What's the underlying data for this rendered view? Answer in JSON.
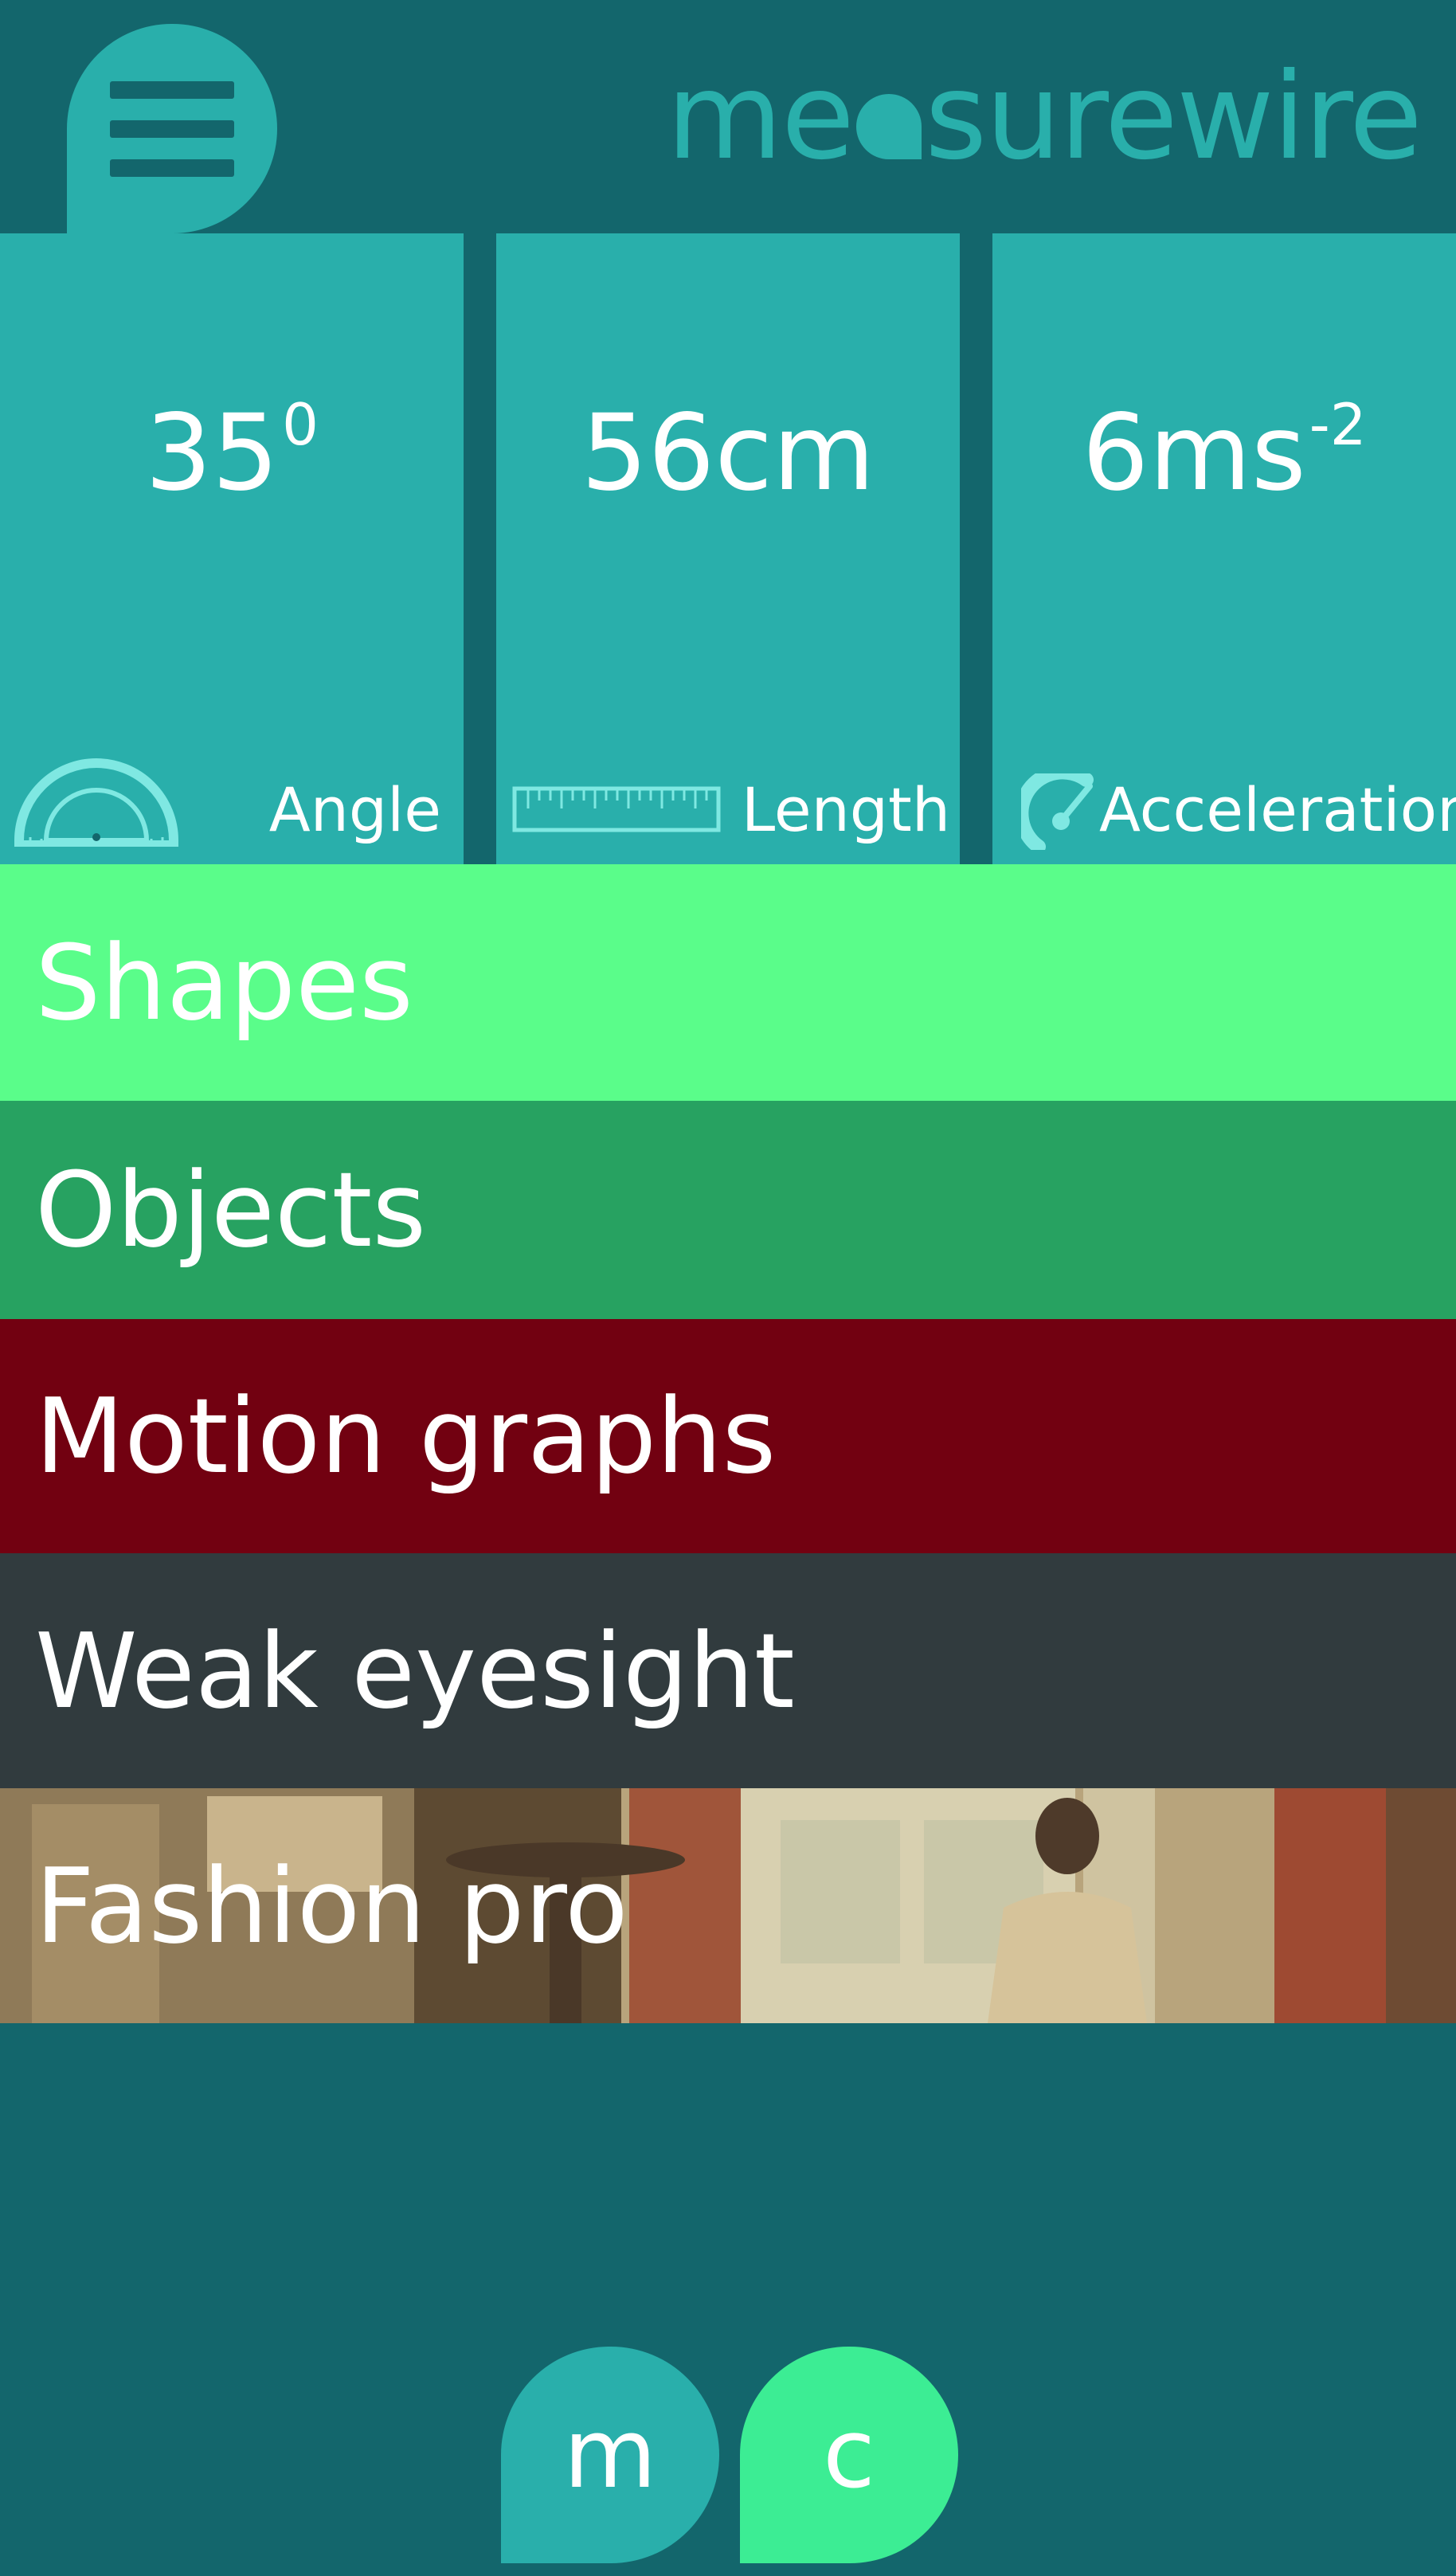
{
  "header": {
    "logo_text_left": "me",
    "logo_text_right": "surewire",
    "menu_icon": "hamburger-menu-icon"
  },
  "tiles": [
    {
      "value": "35",
      "sup": "0",
      "label": "Angle",
      "icon": "protractor-icon"
    },
    {
      "value": "56cm",
      "sup": "",
      "label": "Length",
      "icon": "ruler-icon"
    },
    {
      "value": "6ms",
      "sup": "-2",
      "label": "Acceleration",
      "icon": "speedometer-icon"
    }
  ],
  "rows": [
    {
      "label": "Shapes",
      "color": "#5afd8a"
    },
    {
      "label": "Objects",
      "color": "#27a261"
    },
    {
      "label": "Motion graphs",
      "color": "#720111"
    },
    {
      "label": "Weak eyesight",
      "color": "#313b3e"
    },
    {
      "label": "Fashion pro",
      "color": "#a08c66"
    }
  ],
  "bottom_buttons": [
    {
      "label": "m",
      "color": "#29afab"
    },
    {
      "label": "c",
      "color": "#3ced94"
    }
  ],
  "colors": {
    "background": "#13666c",
    "accent": "#29afab",
    "icon_stroke": "#7fe8e2"
  }
}
